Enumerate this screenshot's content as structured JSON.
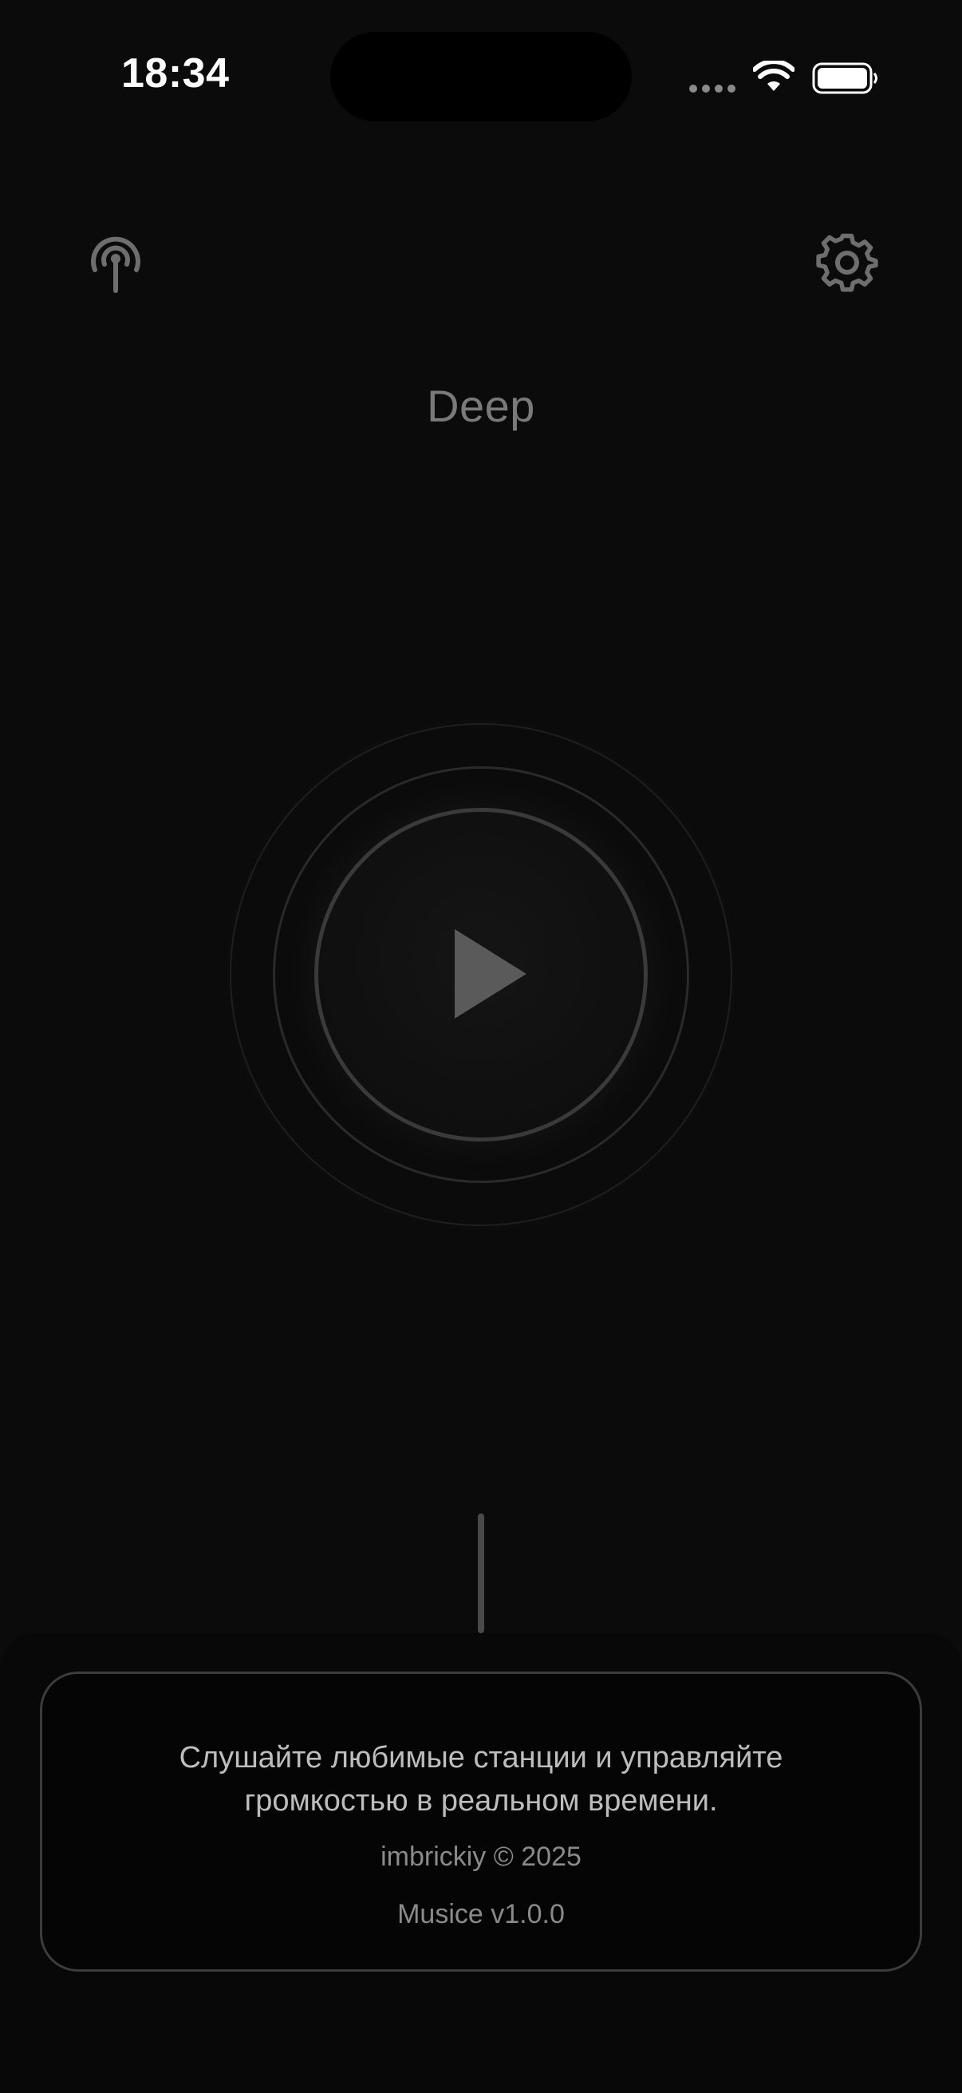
{
  "status_bar": {
    "time": "18:34"
  },
  "header": {
    "radio_icon": "antenna-radiowaves-icon",
    "settings_icon": "gear-icon"
  },
  "station": {
    "name": "Deep"
  },
  "player": {
    "play_icon": "play-icon"
  },
  "info_card": {
    "description_line1": "Слушайте любимые станции и управляйте",
    "description_line2": "громкостью в реальном времени.",
    "author": "imbrickiy © 2025",
    "version": "Musice v1.0.0"
  },
  "colors": {
    "background": "#0b0b0b",
    "icon": "#6e6e6e",
    "title": "#7a7a7a",
    "card_border": "#3c3c3c"
  }
}
